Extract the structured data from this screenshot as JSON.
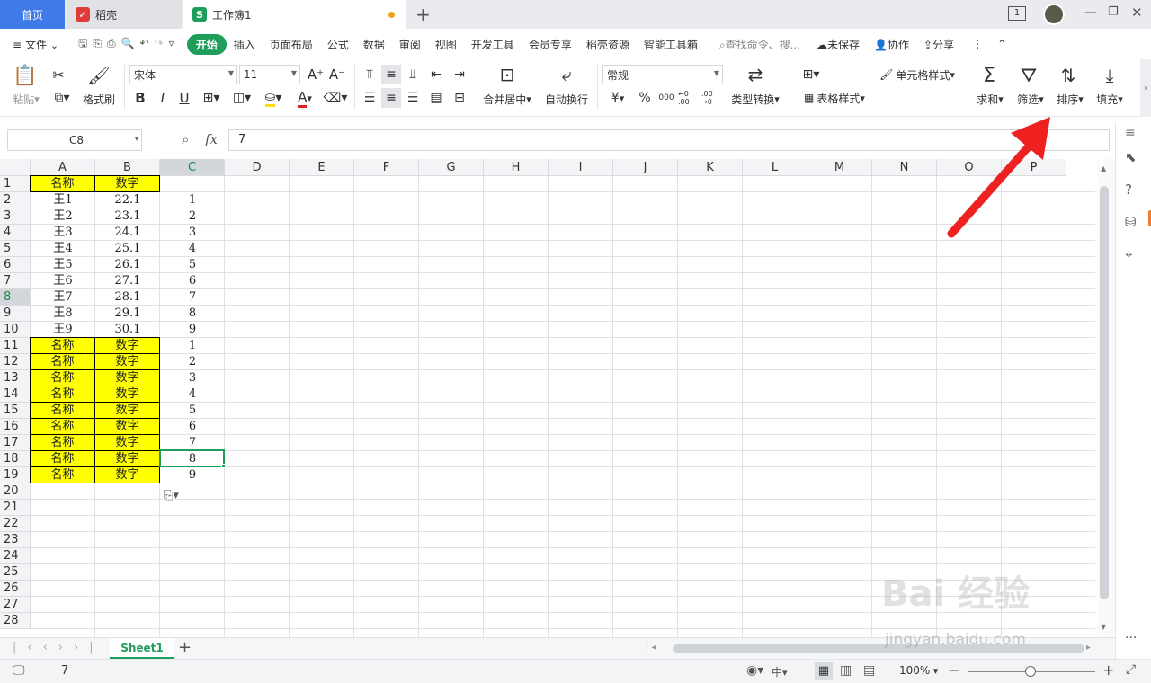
{
  "tabs": {
    "home": "首页",
    "daoke": "稻壳",
    "workbook": "工作簿1"
  },
  "menu": {
    "file": "文件",
    "items": [
      "开始",
      "插入",
      "页面布局",
      "公式",
      "数据",
      "审阅",
      "视图",
      "开发工具",
      "会员专享",
      "稻壳资源",
      "智能工具箱"
    ],
    "search_placeholder": "查找命令、搜...",
    "unsaved": "未保存",
    "collab": "协作",
    "share": "分享"
  },
  "ribbon": {
    "paste": "粘贴",
    "format_painter": "格式刷",
    "font_name": "宋体",
    "font_size": "11",
    "merge_center": "合并居中",
    "wrap_text": "自动换行",
    "number_format": "常规",
    "type_convert": "类型转换",
    "cell_style": "单元格样式",
    "table_style": "表格样式",
    "sum": "求和",
    "filter": "筛选",
    "sort": "排序",
    "fill": "填充",
    "bold": "B",
    "italic": "I",
    "underline": "U",
    "font_color": "A",
    "currency": "¥",
    "percent": "%",
    "thousands": "000",
    "dec_inc": "←0 .00",
    "dec_dec": ".00 →0"
  },
  "formula": {
    "name_box": "C8",
    "fx": "fx",
    "value": "7"
  },
  "grid": {
    "columns": [
      "A",
      "B",
      "C",
      "D",
      "E",
      "F",
      "G",
      "H",
      "I",
      "J",
      "K",
      "L",
      "M",
      "N",
      "O",
      "P"
    ],
    "rows": [
      "1",
      "2",
      "3",
      "4",
      "5",
      "6",
      "7",
      "8",
      "9",
      "10",
      "11",
      "12",
      "13",
      "14",
      "15",
      "16",
      "17",
      "18",
      "19",
      "20",
      "21",
      "22",
      "23",
      "24",
      "25",
      "26",
      "27",
      "28"
    ],
    "data_a": [
      "名称",
      "王1",
      "王2",
      "王3",
      "王4",
      "王5",
      "王6",
      "王7",
      "王8",
      "王9",
      "名称",
      "名称",
      "名称",
      "名称",
      "名称",
      "名称",
      "名称",
      "名称",
      "名称"
    ],
    "data_b": [
      "数字",
      "22.1",
      "23.1",
      "24.1",
      "25.1",
      "26.1",
      "27.1",
      "28.1",
      "29.1",
      "30.1",
      "数字",
      "数字",
      "数字",
      "数字",
      "数字",
      "数字",
      "数字",
      "数字",
      "数字"
    ],
    "data_c": [
      "",
      "1",
      "2",
      "3",
      "4",
      "5",
      "6",
      "7",
      "8",
      "9",
      "1",
      "2",
      "3",
      "4",
      "5",
      "6",
      "7",
      "8",
      "9"
    ],
    "highlight_color": "#ffff00"
  },
  "sheets": {
    "active": "Sheet1"
  },
  "status": {
    "value": "7",
    "lang": "中",
    "zoom": "100%"
  },
  "watermark": {
    "line1": "Bai 经验",
    "line2": "jingyan.baidu.com"
  }
}
